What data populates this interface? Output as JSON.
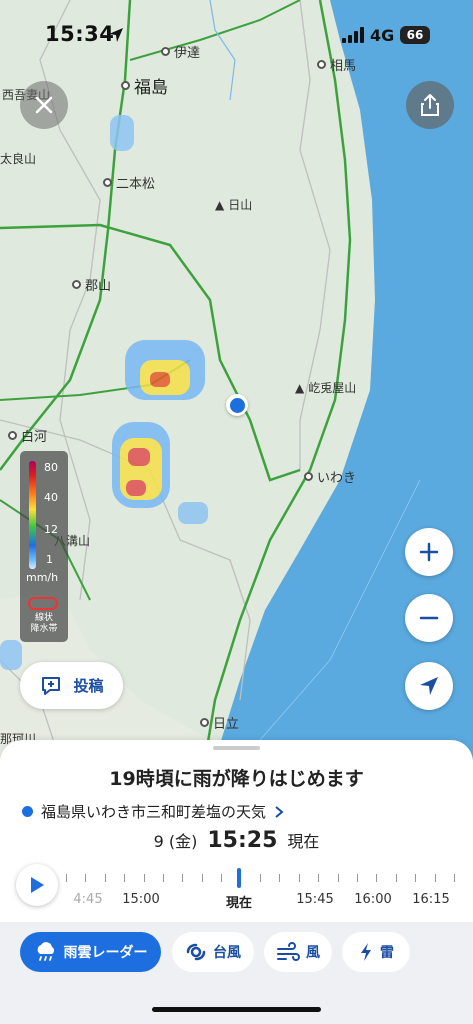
{
  "status_bar": {
    "time": "15:34",
    "network": "4G",
    "battery": "66"
  },
  "map": {
    "cities": [
      {
        "name": "伊達",
        "id": "date"
      },
      {
        "name": "相馬",
        "id": "soma"
      },
      {
        "name": "福島",
        "id": "fukushima"
      },
      {
        "name": "西吾妻山",
        "id": "nishiazuma"
      },
      {
        "name": "太良山",
        "id": "tarayama"
      },
      {
        "name": "二本松",
        "id": "nihonmatsu"
      },
      {
        "name": "日山",
        "id": "hiyama"
      },
      {
        "name": "郡山",
        "id": "koriyama"
      },
      {
        "name": "屹兎屋山",
        "id": "kittoyasan"
      },
      {
        "name": "白河",
        "id": "shirakawa"
      },
      {
        "name": "いわき",
        "id": "iwaki"
      },
      {
        "name": "八溝山",
        "id": "yamizo"
      },
      {
        "name": "日立",
        "id": "hitachi"
      },
      {
        "name": "那珂川",
        "id": "nakagawa"
      }
    ],
    "legend": {
      "values": [
        "80",
        "40",
        "12",
        "1"
      ],
      "unit": "mm/h",
      "band_label": "線状\n降水帯"
    },
    "post_button_label": "投稿"
  },
  "sheet": {
    "headline": "19時頃に雨が降りはじめます",
    "location": "福島県いわき市三和町差塩の天気",
    "date": "9 (金)",
    "time": "15:25",
    "now_label": "現在",
    "timeline": {
      "labels": [
        "4:45",
        "15:00",
        "現在",
        "15:45",
        "16:00",
        "16:15"
      ],
      "selected": "現在"
    }
  },
  "tabs": [
    {
      "label": "雨雲レーダー",
      "icon": "rain-cloud-icon",
      "active": true
    },
    {
      "label": "台風",
      "icon": "typhoon-icon",
      "active": false
    },
    {
      "label": "風",
      "icon": "wind-icon",
      "active": false
    },
    {
      "label": "雷",
      "icon": "lightning-icon",
      "active": false
    }
  ]
}
